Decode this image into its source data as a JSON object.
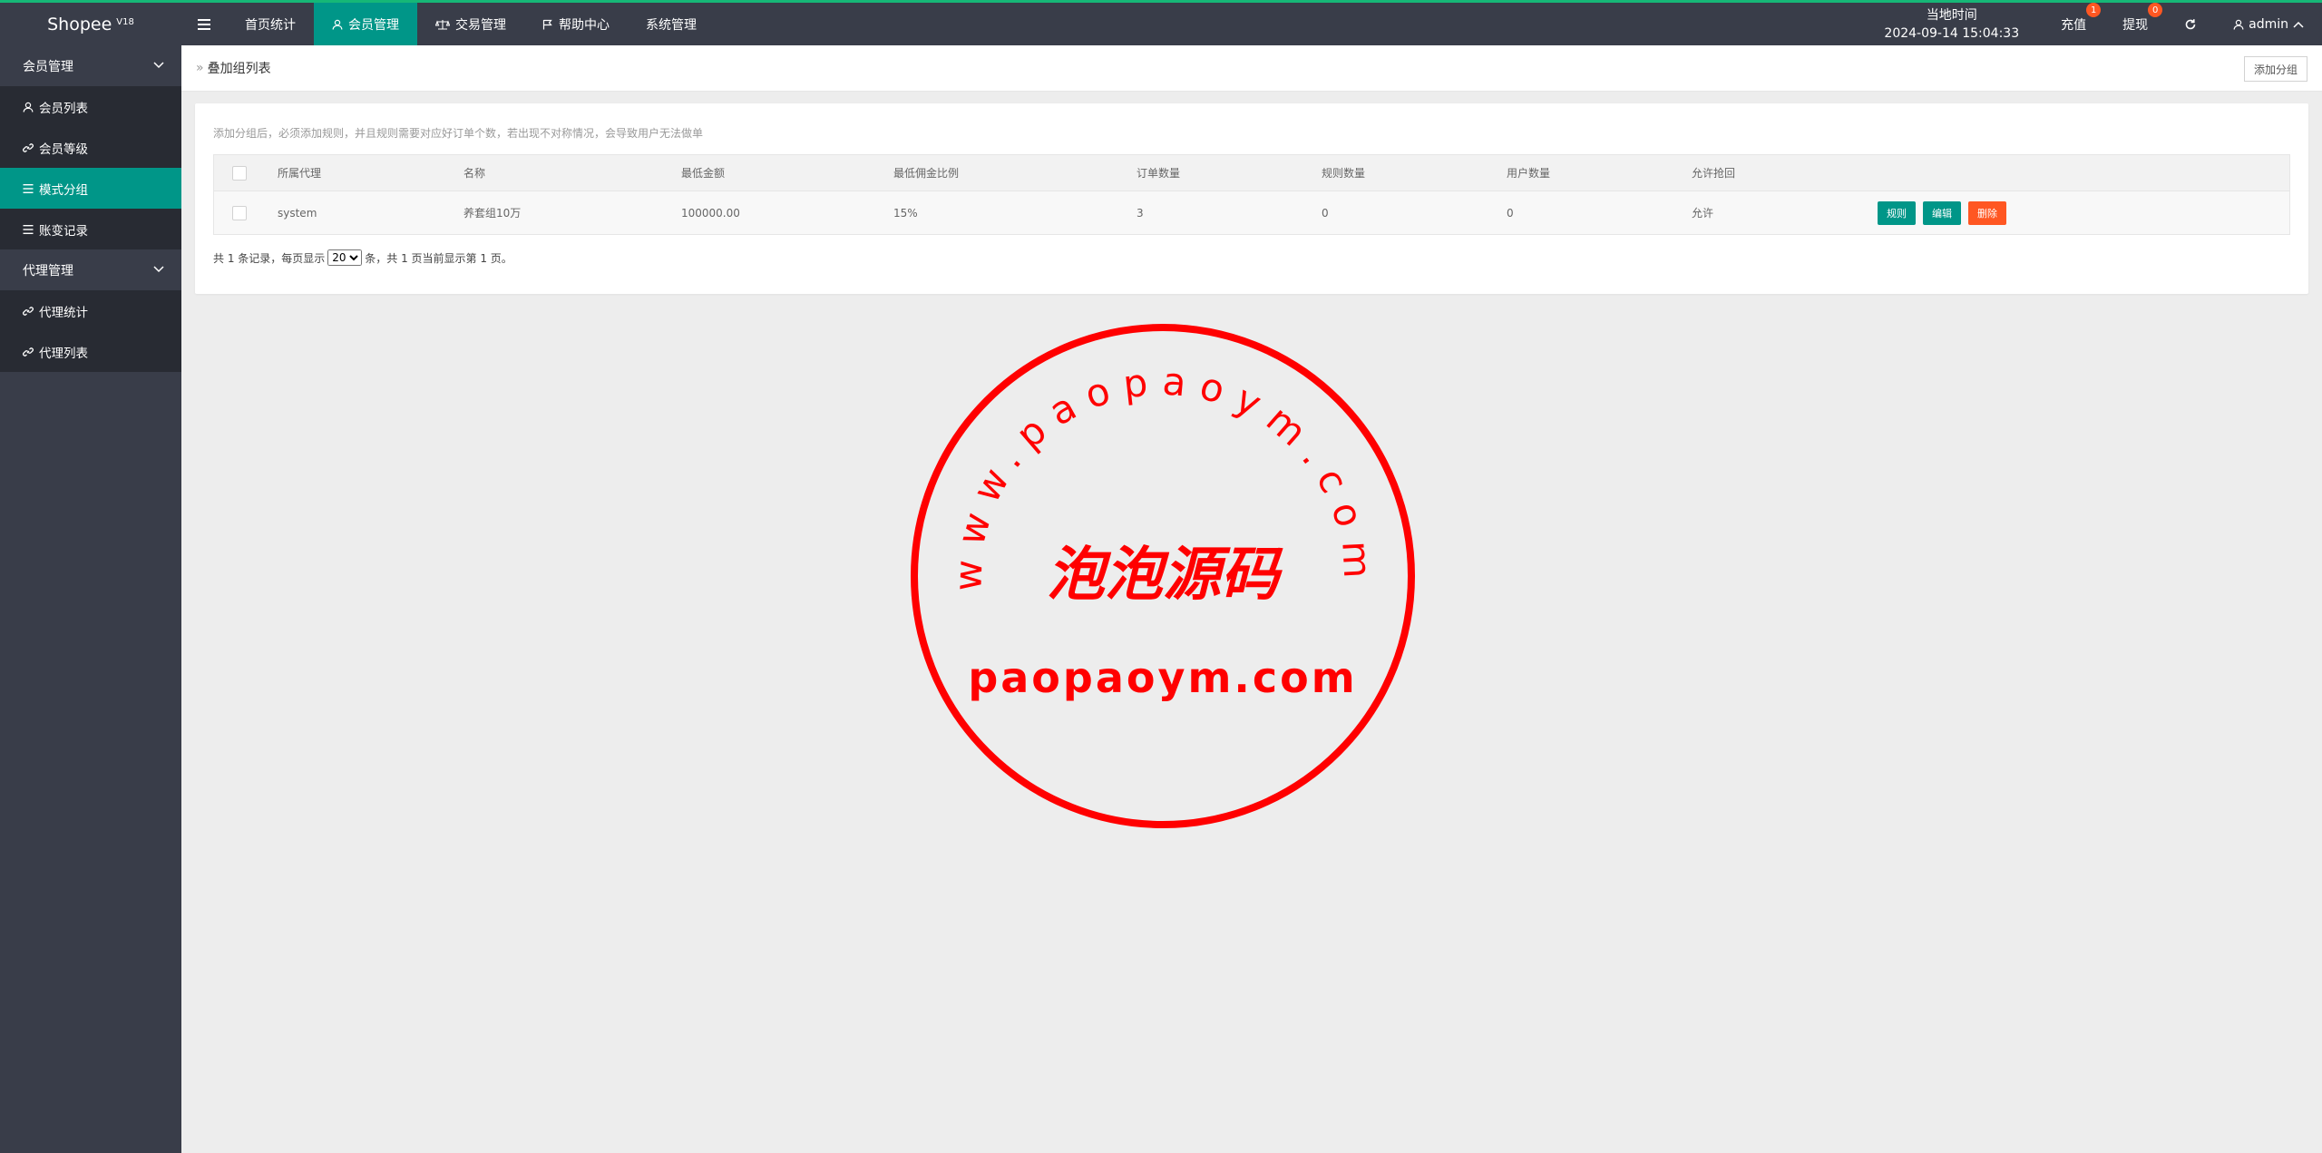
{
  "header": {
    "logo": "Shopee",
    "logo_version": "V18",
    "nav": [
      {
        "label": "首页统计",
        "active": false
      },
      {
        "label": "会员管理",
        "active": true
      },
      {
        "label": "交易管理",
        "active": false
      },
      {
        "label": "帮助中心",
        "active": false
      },
      {
        "label": "系统管理",
        "active": false
      }
    ],
    "clock_label": "当地时间",
    "clock_value": "2024-09-14 15:04:33",
    "recharge_label": "充值",
    "recharge_badge": "1",
    "withdraw_label": "提现",
    "withdraw_badge": "0",
    "user": "admin"
  },
  "sidebar": {
    "groups": [
      {
        "label": "会员管理",
        "items": [
          {
            "label": "会员列表",
            "icon": "user-icon"
          },
          {
            "label": "会员等级",
            "icon": "link-icon"
          },
          {
            "label": "模式分组",
            "icon": "list-icon",
            "active": true
          },
          {
            "label": "账变记录",
            "icon": "list-icon"
          }
        ]
      },
      {
        "label": "代理管理",
        "items": [
          {
            "label": "代理统计",
            "icon": "link-icon"
          },
          {
            "label": "代理列表",
            "icon": "link-icon"
          }
        ]
      }
    ]
  },
  "page": {
    "breadcrumb": "叠加组列表",
    "add_button": "添加分组",
    "tip": "添加分组后，必须添加规则，并且规则需要对应好订单个数，若出现不对称情况，会导致用户无法做单",
    "columns": [
      "所属代理",
      "名称",
      "最低金额",
      "最低佣金比例",
      "订单数量",
      "规则数量",
      "用户数量",
      "允许抢回"
    ],
    "rows": [
      {
        "agent": "system",
        "name": "养套组10万",
        "min_amount": "100000.00",
        "min_rate": "15%",
        "orders": "3",
        "rules": "0",
        "users": "0",
        "allow": "允许"
      }
    ],
    "actions": {
      "rule": "规则",
      "edit": "编辑",
      "delete": "删除"
    },
    "pager": {
      "prefix": "共 1 条记录，每页显示",
      "page_size": "20",
      "suffix": "条，共 1 页当前显示第 1 页。"
    }
  },
  "watermark": {
    "arc_text": "www.paopaoym.com",
    "center_text": "泡泡源码",
    "bottom_text": "paopaoym.com",
    "color": "#ff0000"
  },
  "colors": {
    "accent": "#009688",
    "danger": "#ff5722",
    "topbar": "#393d49",
    "top_border": "#16b777"
  }
}
